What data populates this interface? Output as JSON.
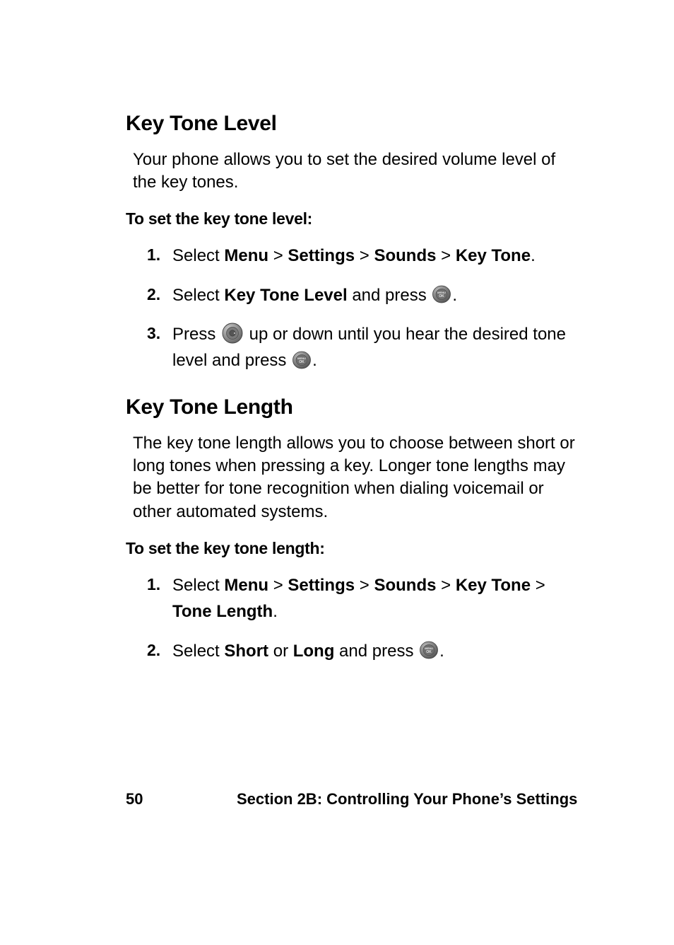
{
  "section1": {
    "heading": "Key Tone Level",
    "intro": "Your phone allows you to set the desired volume level of the key tones.",
    "leadin": "To set the key tone level:",
    "steps": {
      "n1": "1.",
      "s1_a": "Select ",
      "s1_menu": "Menu",
      "s1_gt1": " > ",
      "s1_settings": "Settings",
      "s1_gt2": " > ",
      "s1_sounds": "Sounds",
      "s1_gt3": " > ",
      "s1_keytone": "Key Tone",
      "s1_end": ".",
      "n2": "2.",
      "s2_a": "Select ",
      "s2_ktl": "Key Tone Level",
      "s2_b": " and press ",
      "s2_end": ".",
      "n3": "3.",
      "s3_a": "Press ",
      "s3_b": " up or down until you hear the desired tone level and press ",
      "s3_end": "."
    }
  },
  "section2": {
    "heading": "Key Tone Length",
    "intro": "The key tone length allows you to choose between short or long tones when pressing a key. Longer tone lengths may be better for tone recognition when dialing voicemail or other automated systems.",
    "leadin": "To set the key tone length:",
    "steps": {
      "n1": "1.",
      "s1_a": "Select ",
      "s1_menu": "Menu",
      "s1_gt1": " > ",
      "s1_settings": "Settings",
      "s1_gt2": " > ",
      "s1_sounds": "Sounds",
      "s1_gt3": " > ",
      "s1_keytone": "Key Tone",
      "s1_gt4": " > ",
      "s1_tonelength": "Tone Length",
      "s1_end": ".",
      "n2": "2.",
      "s2_a": "Select ",
      "s2_short": "Short",
      "s2_or": " or ",
      "s2_long": "Long",
      "s2_b": " and press ",
      "s2_end": "."
    }
  },
  "footer": {
    "page": "50",
    "section": "Section 2B: Controlling Your Phone’s Settings"
  },
  "icons": {
    "ok": "menu-ok-button-icon",
    "nav": "nav-button-icon"
  }
}
